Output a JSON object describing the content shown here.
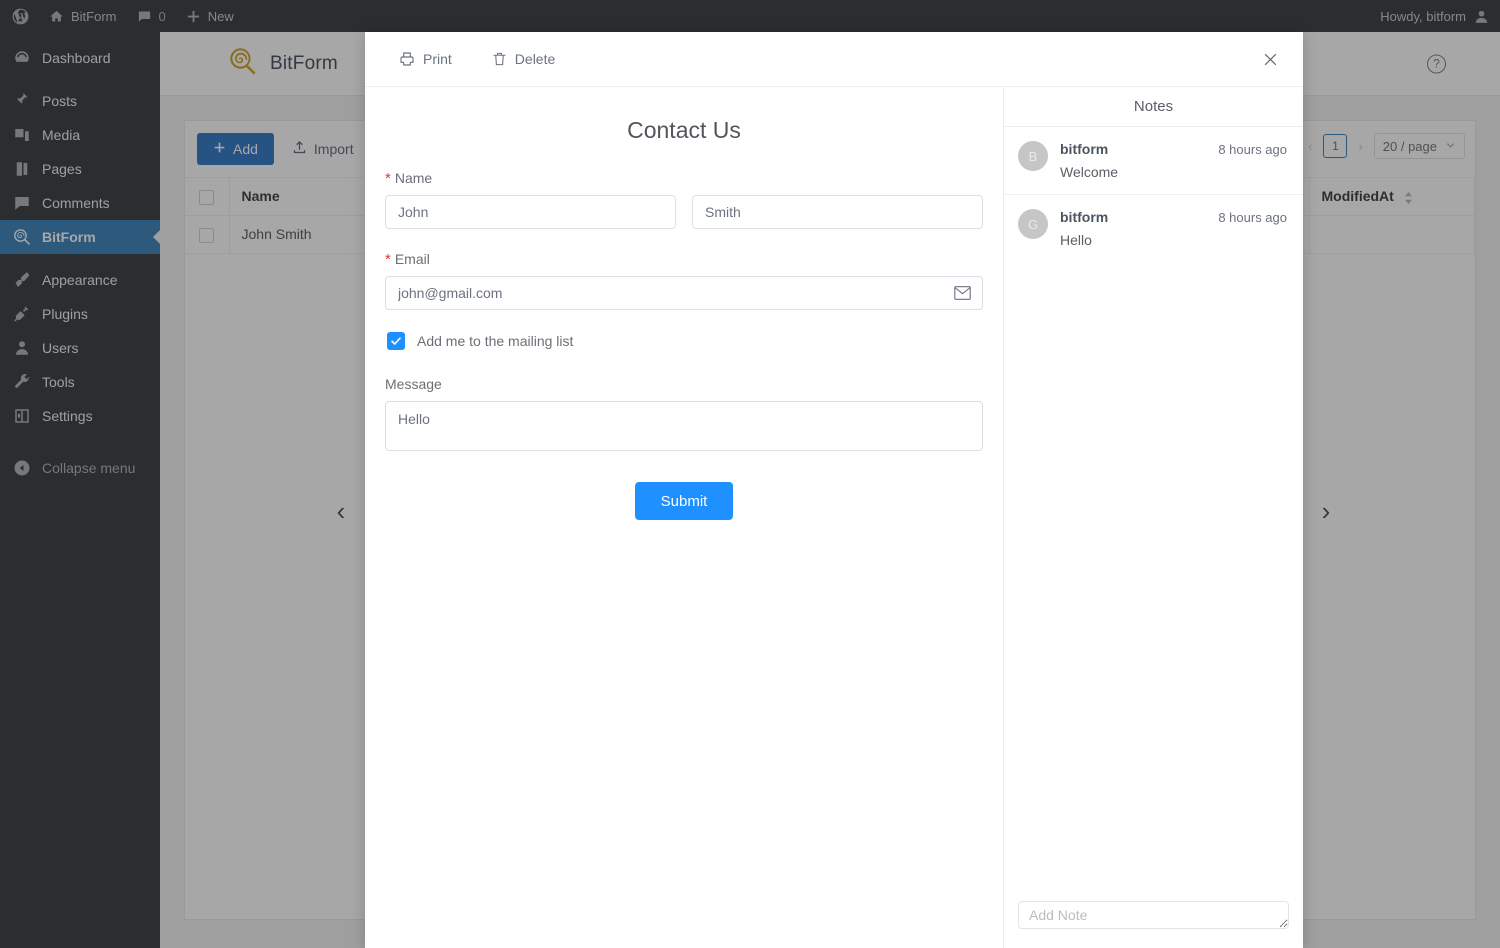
{
  "adminbar": {
    "wp_logo": "wordpress-logo",
    "site_name": "BitForm",
    "comments_count": "0",
    "new_label": "New",
    "howdy": "Howdy, bitform"
  },
  "sidebar": {
    "items": [
      {
        "label": "Dashboard",
        "icon": "dashboard-icon",
        "current": false
      },
      {
        "label": "Posts",
        "icon": "pin-icon",
        "current": false
      },
      {
        "label": "Media",
        "icon": "media-icon",
        "current": false
      },
      {
        "label": "Pages",
        "icon": "pages-icon",
        "current": false
      },
      {
        "label": "Comments",
        "icon": "comment-icon",
        "current": false
      },
      {
        "label": "BitForm",
        "icon": "bitform-icon",
        "current": true
      },
      {
        "label": "Appearance",
        "icon": "brush-icon",
        "current": false
      },
      {
        "label": "Plugins",
        "icon": "plug-icon",
        "current": false
      },
      {
        "label": "Users",
        "icon": "users-icon",
        "current": false
      },
      {
        "label": "Tools",
        "icon": "wrench-icon",
        "current": false
      },
      {
        "label": "Settings",
        "icon": "settings-icon",
        "current": false
      }
    ],
    "collapse_label": "Collapse menu",
    "collapse_icon": "collapse-arrow-icon",
    "highlight_color": "#2271b1"
  },
  "app": {
    "brand_name": "BitForm",
    "brand_icon": "bitform-lollipop-logo",
    "brand_color": "#c8960c",
    "help_icon": "help-circle-icon",
    "toolbar": {
      "add_label": "Add",
      "add_icon": "plus-icon",
      "import_label": "Import",
      "import_icon": "upload-icon",
      "add_color": "#1565c0"
    },
    "pagination": {
      "prev_icon": "chevron-left-icon",
      "page": "1",
      "next_icon": "chevron-right-icon",
      "page_size": "20 / page",
      "caret_icon": "chevron-down-icon"
    },
    "table": {
      "columns": [
        "Name",
        "ModifiedAt"
      ],
      "sort_icon": "sort-caret-icon",
      "rows": [
        {
          "name": "John Smith"
        }
      ]
    }
  },
  "overlay": {
    "prev_record_icon": "chevron-left-icon",
    "next_record_icon": "chevron-right-icon"
  },
  "modal": {
    "header": {
      "print_label": "Print",
      "print_icon": "printer-icon",
      "delete_label": "Delete",
      "delete_icon": "trash-icon",
      "close_icon": "close-icon"
    },
    "form": {
      "title": "Contact Us",
      "name": {
        "label": "Name",
        "required_mark": "*",
        "first_value": "John",
        "last_value": "Smith"
      },
      "email": {
        "label": "Email",
        "required_mark": "*",
        "value": "john@gmail.com",
        "icon": "mail-icon"
      },
      "checkbox": {
        "label": "Add me to the mailing list",
        "checked": true,
        "accent": "#1e90ff"
      },
      "message": {
        "label": "Message",
        "value": "Hello"
      },
      "submit_label": "Submit",
      "submit_color": "#1e90ff"
    },
    "notes": {
      "title": "Notes",
      "items": [
        {
          "avatar": "B",
          "author": "bitform",
          "time": "8 hours ago",
          "text": "Welcome"
        },
        {
          "avatar": "G",
          "author": "bitform",
          "time": "8 hours ago",
          "text": "Hello"
        }
      ],
      "add_placeholder": "Add Note"
    }
  }
}
